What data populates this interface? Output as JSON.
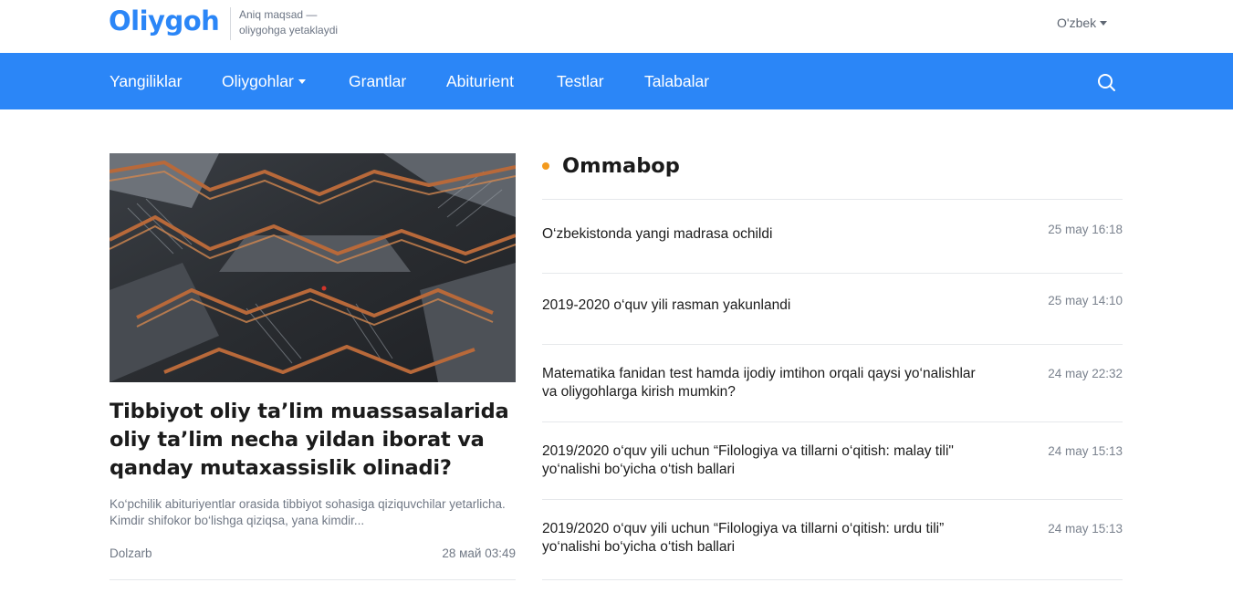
{
  "header": {
    "logo_text": "Oliygoh",
    "tagline_line1": "Aniq maqsad —",
    "tagline_line2": "oliygohga yetaklaydi",
    "language": "O'zbek"
  },
  "nav": {
    "items": [
      {
        "label": "Yangiliklar"
      },
      {
        "label": "Oliygohlar"
      },
      {
        "label": "Grantlar"
      },
      {
        "label": "Abiturient"
      },
      {
        "label": "Testlar"
      },
      {
        "label": "Talabalar"
      }
    ],
    "search_icon": "search-icon"
  },
  "main_article": {
    "title": "Tibbiyot oliy ta’lim muassasalarida oliy ta’lim necha yildan iborat va qanday mutaxassislik olinadi?",
    "excerpt": "Ko‘pchilik abituriyentlar orasida tibbiyot sohasiga qiziquvchilar yetarlicha. Kimdir shifokor bo‘lishga qiziqsa, yana kimdir...",
    "category": "Dolzarb",
    "date": "28 май 03:49"
  },
  "popular": {
    "title": "Ommabop",
    "items": [
      {
        "title": "O‘zbekistonda yangi madrasa ochildi",
        "date": "25 may 16:18"
      },
      {
        "title": "2019-2020 o‘quv yili rasman yakunlandi",
        "date": "25 may 14:10"
      },
      {
        "title": "Matematika fanidan test hamda ijodiy imtihon orqali qaysi yo‘nalishlar va oliygohlarga kirish mumkin?",
        "date": "24 may 22:32"
      },
      {
        "title": "2019/2020 o‘quv yili uchun “Filologiya va tillarni o‘qitish: malay tili\" yo‘nalishi bo‘yicha o‘tish ballari",
        "date": "24 may 15:13"
      },
      {
        "title": "2019/2020 o‘quv yili uchun “Filologiya va tillarni o‘qitish: urdu tili” yo‘nalishi bo‘yicha o‘tish ballari",
        "date": "24 may 15:13"
      }
    ]
  },
  "colors": {
    "brand": "#2b86f7",
    "accent_dot": "#f39a1e",
    "logo_dot": "#f7b01b"
  }
}
